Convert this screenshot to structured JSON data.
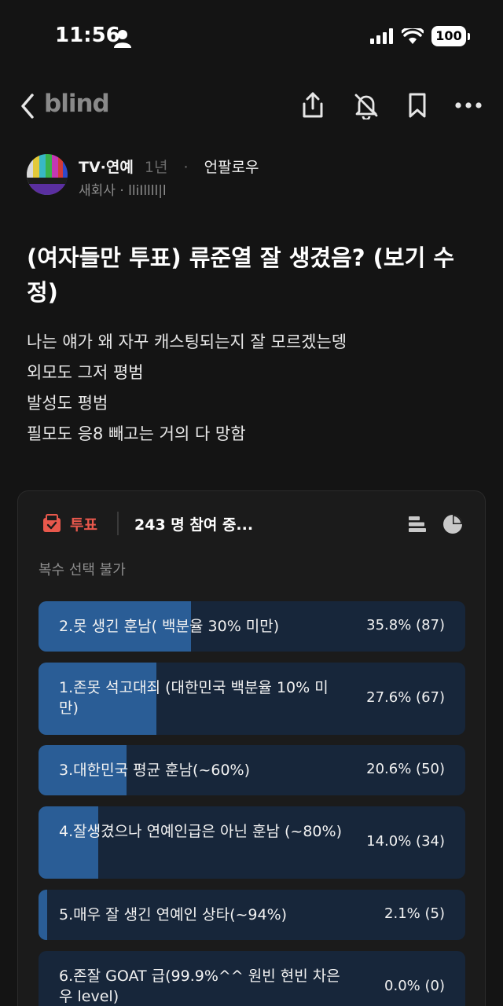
{
  "status": {
    "time": "11:56",
    "battery": "100"
  },
  "nav": {
    "brand": "blind"
  },
  "author": {
    "channel": "TV·연예",
    "time_ago": "1년",
    "follow_tag": "언팔로우",
    "company": "새회사 · lliIllll|l"
  },
  "post": {
    "title": "(여자들만 투표) 류준열 잘 생겼음? (보기 수정)",
    "body": [
      "나는 얘가 왜  자꾸 캐스팅되는지 잘 모르겠는뎅",
      "외모도 그저 평범",
      "발성도 평범",
      "필모도 응8 빼고는 거의 다 망함"
    ]
  },
  "poll": {
    "tag": "투표",
    "participants": "243 명 참여 중...",
    "note": "복수 선택 불가",
    "options": [
      {
        "label": "2.못 생긴 훈남( 백분율 30% 미만)",
        "result": "35.8% (87)",
        "share": 35.8
      },
      {
        "label": "1.존못 석고대죄 (대한민국 백분율 10% 미만)",
        "result": "27.6% (67)",
        "share": 27.6
      },
      {
        "label": "3.대한민국 평균 훈남(~60%)",
        "result": "20.6% (50)",
        "share": 20.6
      },
      {
        "label": "4.잘생겼으나 연예인급은 아닌 훈남 (~80%)",
        "result": "14.0% (34)",
        "share": 14.0
      },
      {
        "label": "5.매우 잘 생긴 연예인 상타(~94%)",
        "result": "2.1% (5)",
        "share": 2.1
      },
      {
        "label": "6.존잘 GOAT 급(99.9%^^ 원빈 현빈 차은우 level)",
        "result": "0.0% (0)",
        "share": 0.0
      }
    ]
  },
  "colors": {
    "background": "#141414",
    "card": "#1b1b1b",
    "bar_track": "#17263a",
    "bar_fill": "#2a5d96",
    "poll_accent": "#e8584c"
  }
}
